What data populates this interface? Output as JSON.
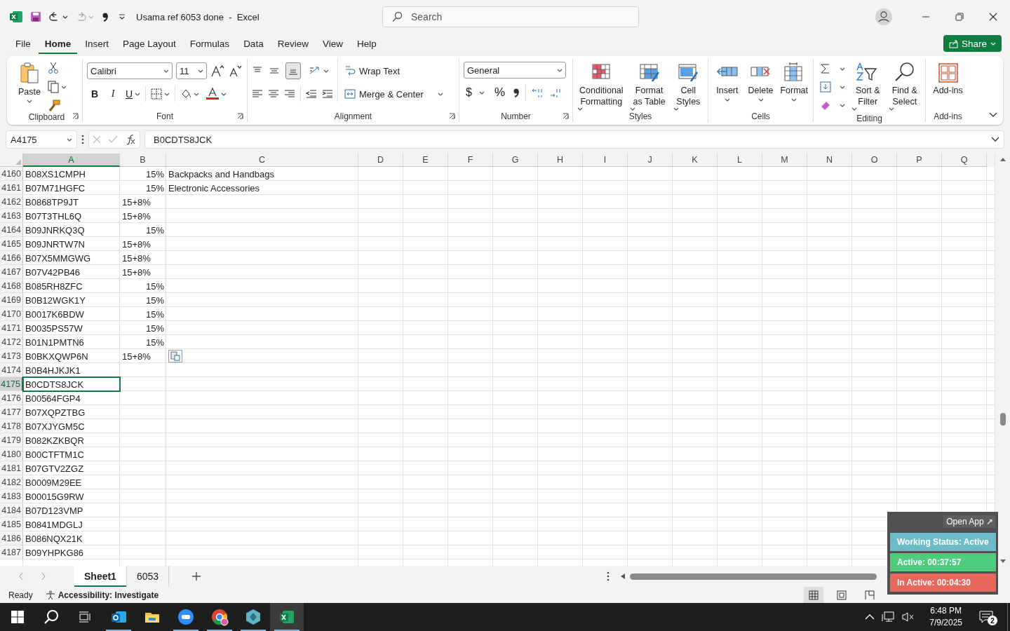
{
  "title_bar": {
    "title": "Usama ref 6053 done  -  Excel",
    "search_placeholder": "Search",
    "quick_access": [
      {
        "kind": "undo",
        "disabled": false
      },
      {
        "kind": "redo",
        "disabled": true
      }
    ]
  },
  "menu_tabs": [
    {
      "label": "File",
      "selected": false
    },
    {
      "label": "Home",
      "selected": true
    },
    {
      "label": "Insert",
      "selected": false
    },
    {
      "label": "Page Layout",
      "selected": false
    },
    {
      "label": "Formulas",
      "selected": false
    },
    {
      "label": "Data",
      "selected": false
    },
    {
      "label": "Review",
      "selected": false
    },
    {
      "label": "View",
      "selected": false
    },
    {
      "label": "Help",
      "selected": false
    }
  ],
  "share_button": "Share",
  "ribbon": {
    "clipboard": {
      "label": "Clipboard",
      "paste": "Paste"
    },
    "font": {
      "label": "Font",
      "font_name": "Calibri",
      "font_size": "11",
      "bold": "B",
      "italic": "I",
      "underline": "U"
    },
    "alignment": {
      "label": "Alignment",
      "wrap_text": "Wrap Text",
      "merge": "Merge & Center"
    },
    "number": {
      "label": "Number",
      "format": "General",
      "currency": "$",
      "percent": "%"
    },
    "styles": {
      "label": "Styles",
      "buttons": [
        {
          "kind": "conditional",
          "label": "Conditional Formatting"
        },
        {
          "kind": "table",
          "label": "Format as Table"
        },
        {
          "kind": "cellstyles",
          "label": "Cell Styles"
        }
      ]
    },
    "cells": {
      "label": "Cells",
      "buttons": [
        {
          "kind": "insert",
          "label": "Insert"
        },
        {
          "kind": "delete",
          "label": "Delete"
        },
        {
          "kind": "format",
          "label": "Format"
        }
      ]
    },
    "editing": {
      "label": "Editing",
      "buttons": [
        {
          "kind": "sort",
          "label": "Sort & Filter"
        },
        {
          "kind": "find",
          "label": "Find & Select"
        }
      ]
    },
    "addins": {
      "label": "Add-ins",
      "button": "Add-ins"
    }
  },
  "formula_bar": {
    "name_box": "A4175",
    "value": "B0CDTS8JCK"
  },
  "columns": [
    {
      "label": "A",
      "selected": true
    },
    {
      "label": "B",
      "selected": false
    },
    {
      "label": "C",
      "selected": false
    },
    {
      "label": "D",
      "selected": false
    },
    {
      "label": "E",
      "selected": false
    },
    {
      "label": "F",
      "selected": false
    },
    {
      "label": "G",
      "selected": false
    },
    {
      "label": "H",
      "selected": false
    },
    {
      "label": "I",
      "selected": false
    },
    {
      "label": "J",
      "selected": false
    },
    {
      "label": "K",
      "selected": false
    },
    {
      "label": "L",
      "selected": false
    },
    {
      "label": "M",
      "selected": false
    },
    {
      "label": "N",
      "selected": false
    },
    {
      "label": "O",
      "selected": false
    },
    {
      "label": "P",
      "selected": false
    },
    {
      "label": "Q",
      "selected": false
    }
  ],
  "rows": [
    {
      "number": "4160",
      "a": "B08XS1CMPH",
      "b": "15%",
      "b_numeric": true,
      "c": "Backpacks and Handbags",
      "selected": false
    },
    {
      "number": "4161",
      "a": "B07M71HGFC",
      "b": "15%",
      "b_numeric": true,
      "c": "Electronic Accessories",
      "selected": false
    },
    {
      "number": "4162",
      "a": "B0868TP9JT",
      "b": "15+8%",
      "b_numeric": false,
      "selected": false
    },
    {
      "number": "4163",
      "a": "B07T3THL6Q",
      "b": "15+8%",
      "b_numeric": false,
      "selected": false
    },
    {
      "number": "4164",
      "a": "B09JNRKQ3Q",
      "b": "15%",
      "b_numeric": true,
      "selected": false
    },
    {
      "number": "4165",
      "a": "B09JNRTW7N",
      "b": "15+8%",
      "b_numeric": false,
      "selected": false
    },
    {
      "number": "4166",
      "a": "B07X5MMGWG",
      "b": "15+8%",
      "b_numeric": false,
      "selected": false
    },
    {
      "number": "4167",
      "a": "B07V42PB46",
      "b": "15+8%",
      "b_numeric": false,
      "selected": false
    },
    {
      "number": "4168",
      "a": "B085RH8ZFC",
      "b": "15%",
      "b_numeric": true,
      "selected": false
    },
    {
      "number": "4169",
      "a": "B0B12WGK1Y",
      "b": "15%",
      "b_numeric": true,
      "selected": false
    },
    {
      "number": "4170",
      "a": "B0017K6BDW",
      "b": "15%",
      "b_numeric": true,
      "selected": false
    },
    {
      "number": "4171",
      "a": "B0035PS57W",
      "b": "15%",
      "b_numeric": true,
      "selected": false
    },
    {
      "number": "4172",
      "a": "B01N1PMTN6",
      "b": "15%",
      "b_numeric": true,
      "selected": false
    },
    {
      "number": "4173",
      "a": "B0BKXQWP6N",
      "b": "15+8%",
      "b_numeric": false,
      "paste_options": true,
      "selected": false
    },
    {
      "number": "4174",
      "a": "B0B4HJKJK1",
      "selected": false
    },
    {
      "number": "4175",
      "a": "B0CDTS8JCK",
      "selected": true
    },
    {
      "number": "4176",
      "a": "B00564FGP4",
      "selected": false
    },
    {
      "number": "4177",
      "a": "B07XQPZTBG",
      "selected": false
    },
    {
      "number": "4178",
      "a": "B07XJYGM5C",
      "selected": false
    },
    {
      "number": "4179",
      "a": "B082KZKBQR",
      "selected": false
    },
    {
      "number": "4180",
      "a": "B00CTFTM1C",
      "selected": false
    },
    {
      "number": "4181",
      "a": "B07GTV2ZGZ",
      "selected": false
    },
    {
      "number": "4182",
      "a": "B0009M29EE",
      "selected": false
    },
    {
      "number": "4183",
      "a": "B00015G9RW",
      "selected": false
    },
    {
      "number": "4184",
      "a": "B07D123VMP",
      "selected": false
    },
    {
      "number": "4185",
      "a": "B0841MDGLJ",
      "selected": false
    },
    {
      "number": "4186",
      "a": "B086NQX21K",
      "selected": false
    },
    {
      "number": "4187",
      "a": "B09YHPKG86",
      "selected": false
    }
  ],
  "sheet_tabs": [
    {
      "label": "Sheet1",
      "selected": true
    },
    {
      "label": "6053",
      "selected": false
    }
  ],
  "status_bar": {
    "ready": "Ready",
    "accessibility": "Accessibility: Investigate",
    "views": [
      {
        "kind": "normal",
        "selected": true
      },
      {
        "kind": "layout",
        "selected": false
      },
      {
        "kind": "pagebreak",
        "selected": false
      }
    ]
  },
  "tracker": {
    "open_app": "Open App ↗",
    "items": [
      {
        "text": "Working Status: Active",
        "color": "#6cbcc8"
      },
      {
        "text": "Active: 00:37:57",
        "color": "#4ccc7c"
      },
      {
        "text": "In Active: 00:04:30",
        "color": "#e8675c"
      }
    ]
  },
  "taskbar": {
    "apps": [
      {
        "kind": "outlook",
        "running": true,
        "selected": false
      },
      {
        "kind": "explorer",
        "running": false,
        "selected": false
      },
      {
        "kind": "zoom",
        "running": true,
        "selected": false
      },
      {
        "kind": "chrome",
        "running": true,
        "selected": false
      },
      {
        "kind": "hexapp",
        "running": true,
        "selected": false
      },
      {
        "kind": "excel",
        "running": true,
        "selected": true
      }
    ],
    "time": "6:48 PM",
    "date": "7/9/2025",
    "notifications": "2"
  }
}
